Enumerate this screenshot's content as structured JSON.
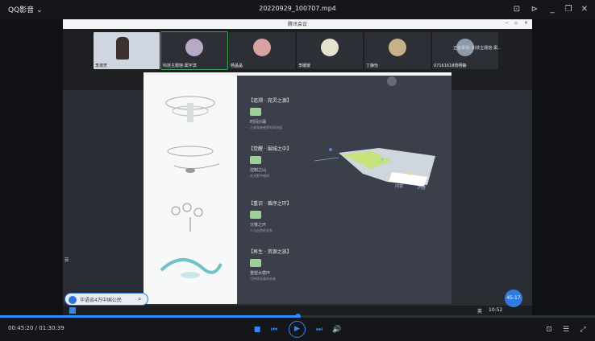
{
  "player": {
    "brand": "QQ影音",
    "filename": "20220929_100707.mp4",
    "timecode": "00:45:20 / 01:30:39",
    "progress": 0.5
  },
  "meeting": {
    "window_title": "腾讯会议",
    "participants": [
      {
        "name": "李淑芳"
      },
      {
        "name": "科技主题馆-窦宇滨"
      },
      {
        "name": "杨晶晶"
      },
      {
        "name": "李媛媛"
      },
      {
        "name": "丁静怡"
      },
      {
        "name": "07161618杨明静"
      }
    ],
    "speaking": "正在讲话: 科技主题馆-窦..."
  },
  "slide": {
    "sections": [
      {
        "title": "【追溯 · 宛灵之源】",
        "sub": "时间沙漏",
        "note": "让参观者感受时间流逝"
      },
      {
        "title": "【觉醒 · 围城之中】",
        "sub": "控制之山",
        "note": "在光影中感知"
      },
      {
        "title": "【重识 · 循序之环】",
        "sub": "分散之环",
        "note": "人与自然的关系"
      },
      {
        "title": "【再生 · 资源之旅】",
        "sub": "重塑水循环",
        "note": "可持续发展的未来"
      }
    ],
    "map_labels": [
      "内容",
      "内容"
    ]
  },
  "taskbar": {
    "search_text": "华语谈4万中国公民",
    "clock": "10:52",
    "lang": "英"
  },
  "timer_badge": "45:17"
}
